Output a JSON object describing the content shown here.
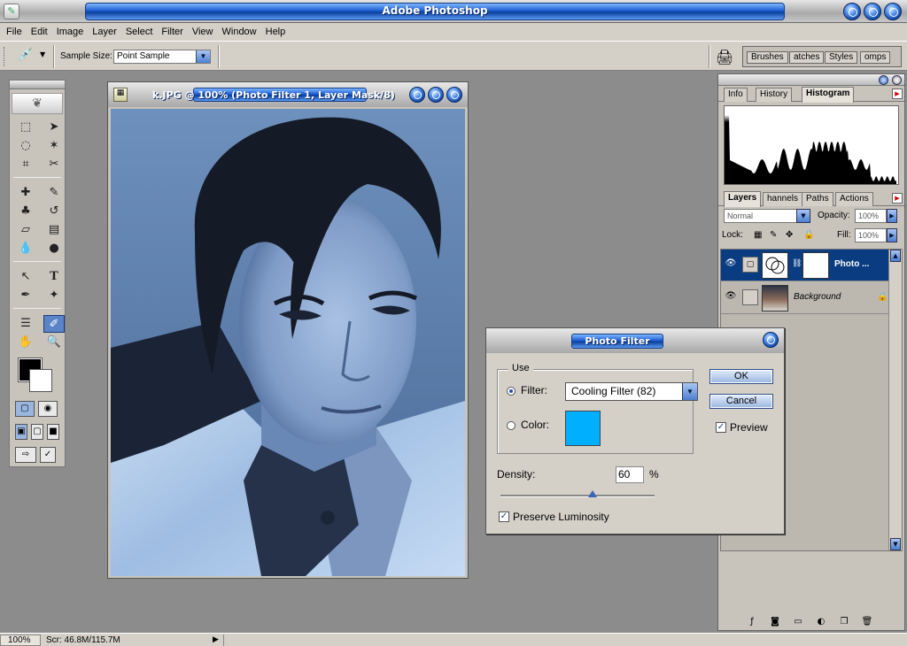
{
  "app": {
    "title": "Adobe Photoshop"
  },
  "menu": [
    "File",
    "Edit",
    "Image",
    "Layer",
    "Select",
    "Filter",
    "View",
    "Window",
    "Help"
  ],
  "options": {
    "sample_size_label": "Sample Size:",
    "sample_size_value": "Point Sample"
  },
  "palette_well_tabs": [
    "Brushes",
    "atches",
    "Styles",
    "omps"
  ],
  "document": {
    "title": "k.JPG @ 100% (Photo Filter 1, Layer Mask/8)"
  },
  "info_tabs": [
    "Info",
    "History",
    "Histogram"
  ],
  "layers_panel": {
    "tabs": [
      "Layers",
      "hannels",
      "Paths",
      "Actions"
    ],
    "blend_mode": "Normal",
    "opacity_label": "Opacity:",
    "opacity_value": "100%",
    "lock_label": "Lock:",
    "fill_label": "Fill:",
    "fill_value": "100%",
    "layers": [
      {
        "name": "Photo ...",
        "selected": true
      },
      {
        "name": "Background",
        "selected": false
      }
    ]
  },
  "dialog": {
    "title": "Photo Filter",
    "use_label": "Use",
    "filter_label": "Filter:",
    "filter_value": "Cooling Filter (82)",
    "color_label": "Color:",
    "color_swatch": "#00b0ff",
    "density_label": "Density:",
    "density_value": "60",
    "density_unit": "%",
    "density_fraction": 0.6,
    "preserve_label": "Preserve Luminosity",
    "ok_label": "OK",
    "cancel_label": "Cancel",
    "preview_label": "Preview"
  },
  "status": {
    "zoom": "100%",
    "scratch": "Scr: 46.8M/115.7M"
  }
}
